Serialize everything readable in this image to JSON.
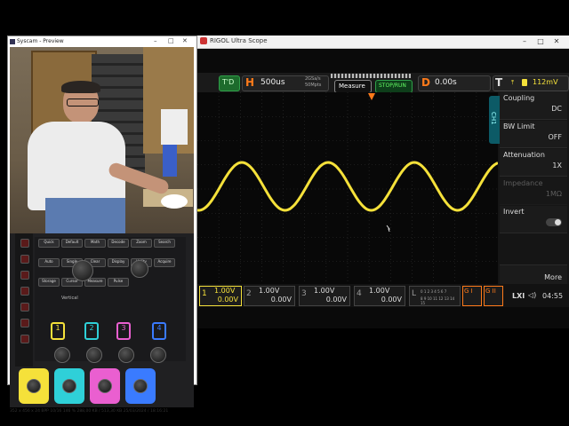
{
  "scope_window": {
    "title": "RIGOL Ultra Scope",
    "toolbar": {
      "trig_mode": "T'D",
      "h_letter": "H",
      "h_value": "500us",
      "sample_rate": "2GSa/s",
      "mem_depth": "50Mpts",
      "measure": "Measure",
      "run_state": "STOP/RUN",
      "d_letter": "D",
      "d_value": "0.00s",
      "t_letter": "T",
      "t_value": "112mV"
    },
    "side_panel": {
      "tab": "CH1",
      "items": [
        {
          "label": "Coupling",
          "value": "DC"
        },
        {
          "label": "BW Limit",
          "value": "OFF"
        },
        {
          "label": "Attenuation",
          "value": "1X"
        },
        {
          "label": "Impedance",
          "value": "1MΩ"
        },
        {
          "label": "Invert",
          "value": ""
        }
      ],
      "more": "More"
    },
    "channels": [
      {
        "num": "1",
        "scale": "1.00V",
        "offset": "0.00V",
        "color": "#f5e13a"
      },
      {
        "num": "2",
        "scale": "1.00V",
        "offset": "0.00V",
        "color": "#999999"
      },
      {
        "num": "3",
        "scale": "1.00V",
        "offset": "0.00V",
        "color": "#999999"
      },
      {
        "num": "4",
        "scale": "1.00V",
        "offset": "0.00V",
        "color": "#999999"
      }
    ],
    "logic_label": "L",
    "logic_bits_1": "0 1 2 3 4 5 6 7",
    "logic_bits_2": "8 9 10 11 12 13 14 15",
    "gen1": "G I",
    "gen2": "G II",
    "clock": "04:55",
    "trace_color": "#f5e13a"
  },
  "preview_window": {
    "title": "Syscam - Preview",
    "status": "352 x 456 x 24 BPP    10/16    146 %    288,00 KB / 513,30 KB    25/03/2024 / 18:16:21",
    "panel_buttons": [
      "Quick",
      "Default",
      "Math",
      "Decode",
      "Zoom",
      "Search",
      "Auto",
      "Single",
      "Clear",
      "Display",
      "Utility",
      "Acquire",
      "Storage",
      "Cursor",
      "Measure",
      "Pulse"
    ],
    "vertical_label": "Vertical",
    "channel_buttons": [
      "1",
      "2",
      "3",
      "4"
    ],
    "channel_colors": [
      "#f5e13a",
      "#2fd0d8",
      "#ea5fd0",
      "#3a7bff"
    ]
  }
}
